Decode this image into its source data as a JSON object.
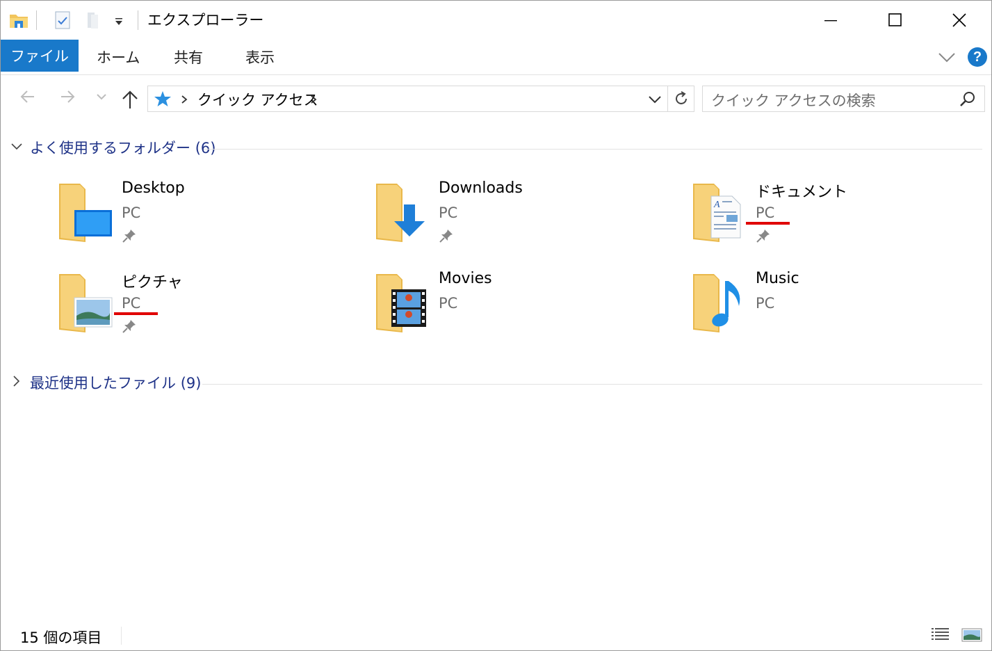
{
  "window": {
    "title": "エクスプローラー",
    "accent_color": "#1979ca"
  },
  "ribbon": {
    "tabs": [
      {
        "label": "ファイル",
        "active": true
      },
      {
        "label": "ホーム"
      },
      {
        "label": "共有"
      },
      {
        "label": "表示"
      }
    ],
    "help_label": "?"
  },
  "navigation": {
    "breadcrumb": [
      "クイック アクセス"
    ],
    "search_placeholder": "クイック アクセスの検索"
  },
  "frequent_folders": {
    "title": "よく使用するフォルダー",
    "count": "(6)",
    "expanded": true,
    "items": [
      {
        "name": "Desktop",
        "location": "PC",
        "pinned": true,
        "icon": "desktop-folder-icon"
      },
      {
        "name": "Downloads",
        "location": "PC",
        "pinned": true,
        "icon": "downloads-folder-icon"
      },
      {
        "name": "ドキュメント",
        "location": "PC",
        "pinned": true,
        "icon": "documents-folder-icon",
        "underlined": true
      },
      {
        "name": "ピクチャ",
        "location": "PC",
        "pinned": true,
        "icon": "pictures-folder-icon",
        "underlined": true
      },
      {
        "name": "Movies",
        "location": "PC",
        "pinned": false,
        "icon": "movies-folder-icon"
      },
      {
        "name": "Music",
        "location": "PC",
        "pinned": false,
        "icon": "music-folder-icon"
      }
    ]
  },
  "recent_files": {
    "title": "最近使用したファイル",
    "count": "(9)",
    "expanded": false
  },
  "status": {
    "item_count": "15 個の項目"
  },
  "highlight_color": "#e00000"
}
